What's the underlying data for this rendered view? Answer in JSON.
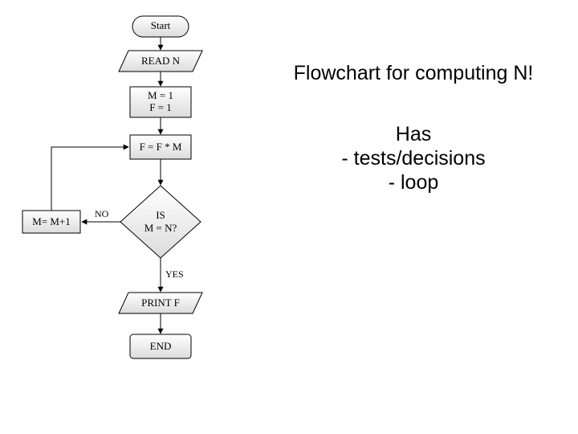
{
  "title": "Flowchart for computing N!",
  "notes": {
    "heading": "Has",
    "line1": "-  tests/decisions",
    "line2": "- loop"
  },
  "nodes": {
    "start": "Start",
    "read": "READ N",
    "init1": "M = 1",
    "init2": "F = 1",
    "mult": "F = F * M",
    "dec1": "IS",
    "dec2": "M = N?",
    "inc": "M= M+1",
    "print": "PRINT F",
    "end": "END"
  },
  "edges": {
    "no": "NO",
    "yes": "YES"
  }
}
